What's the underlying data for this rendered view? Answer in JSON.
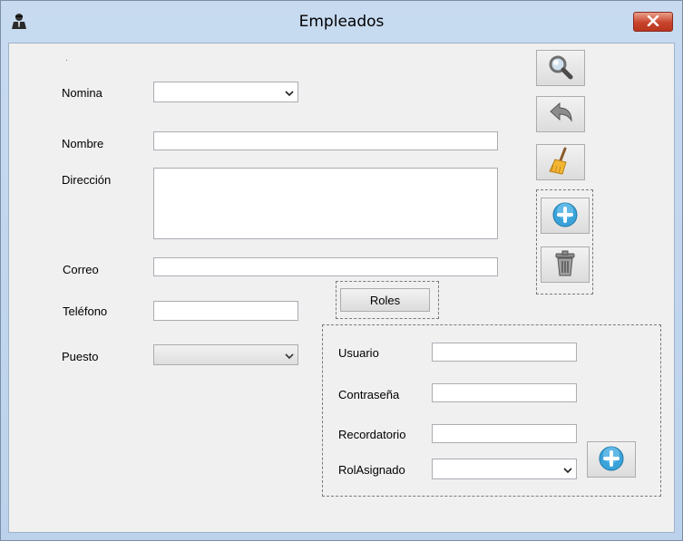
{
  "window": {
    "title": "Empleados",
    "icons": {
      "app": "user-icon",
      "close": "close-icon"
    }
  },
  "form": {
    "nomina_label": "Nomina",
    "nomina_value": "",
    "nombre_label": "Nombre",
    "nombre_value": "",
    "direccion_label": "Dirección",
    "direccion_value": "",
    "correo_label": "Correo",
    "correo_value": "",
    "telefono_label": "Teléfono",
    "telefono_value": "",
    "puesto_label": "Puesto",
    "puesto_value": "",
    "roles_button": "Roles"
  },
  "user_panel": {
    "usuario_label": "Usuario",
    "usuario_value": "",
    "contrasena_label": "Contraseña",
    "contrasena_value": "",
    "recordatorio_label": "Recordatorio",
    "recordatorio_value": "",
    "rol_label": "RolAsignado",
    "rol_value": ""
  },
  "toolbar_icons": [
    "search-icon",
    "undo-icon",
    "broom-icon",
    "add-icon",
    "trash-icon"
  ],
  "colors": {
    "close_button": "#c9432b",
    "add_icon": "#3aa3d9"
  }
}
